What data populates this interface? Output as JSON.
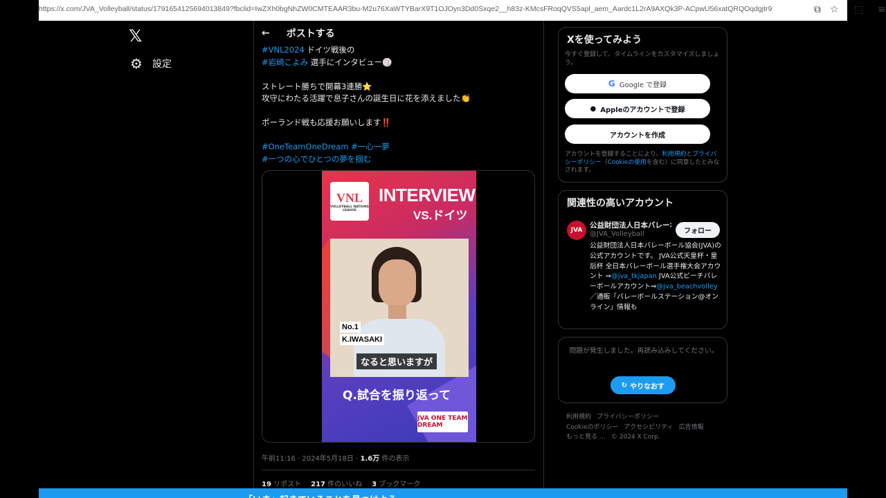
{
  "browser": {
    "url": "https://x.com/JVA_Volleyball/status/1791654125694013849?fbclid=IwZXh0bgNhZW0CMTEAAR3bu-M2u76XaWTYBarX9T1OJOyn3Dd0Sxqe2__h83z-KMcsFRoqQVS5apl_aem_Aardc1L2rA9AXQk3P-ACpwU56xatQRQOqdgjtr9T2..."
  },
  "nav": {
    "logo": "𝕏",
    "settings_label": "設定"
  },
  "post": {
    "header_title": "ポストする",
    "lines": [
      {
        "tag": "#VNL2024",
        "text": " ドイツ戦後の"
      },
      {
        "tag": "#岩崎こよみ",
        "text": " 選手にインタビュー🏐"
      },
      {
        "tag": "",
        "text": "ストレート勝ちで開幕3連勝⭐"
      },
      {
        "tag": "",
        "text": "攻守にわたる活躍で息子さんの誕生日に花を添えました👏"
      },
      {
        "tag": "",
        "text": "ポーランド戦も応援お願いします‼️"
      },
      {
        "tag": "#OneTeamOneDream #一心一夢",
        "text": ""
      },
      {
        "tag": "#一つの心でひとつの夢を掴む",
        "text": ""
      }
    ],
    "media": {
      "logo_text": "VNL",
      "logo_sub": "VOLLEYBALL NATIONS LEAGUE",
      "title": "INTERVIEW",
      "vs": "VS.ドイツ",
      "player_no": "No.1",
      "player_name": "K.IWASAKI",
      "subtitle": "なると思いますが",
      "question": "Q.試合を振り返って",
      "badge": "JVA ONE TEAM DREAM"
    },
    "time": "午前11:16 · 2024年5月18日 · ",
    "views": "1.6万",
    "views_label": " 件の表示",
    "retweets": "19",
    "retweets_label": " リポスト",
    "likes": "217",
    "likes_label": " 件のいいね",
    "bookmarks": "3",
    "bookmarks_label": " ブックマーク"
  },
  "signup": {
    "title": "Xを使ってみよう",
    "desc": "今すぐ登録して、タイムラインをカスタマイズしましょう。",
    "google_btn": "Google で登録",
    "apple_btn": "Appleのアカウントで登録",
    "create_btn": "アカウントを作成",
    "legal_prefix": "アカウントを登録することにより、",
    "legal_terms": "利用規約",
    "legal_and": "と",
    "legal_privacy": "プライバシーポリシー",
    "legal_cookie_open": "（",
    "legal_cookie": "Cookieの使用",
    "legal_suffix": "を含む）に同意したとみなされます。"
  },
  "related": {
    "title": "関連性の高いアカウント",
    "name": "公益財団法人日本バレーボール協会",
    "handle": "@JVA_Volleyball",
    "follow": "フォロー",
    "bio_1": "公益財団法人日本バレーボール協会(JVA)の公式アカウントです。 JVA公式天皇杯・皇后杯 全日本バレーボール選手権大会アカウント ⇒",
    "bio_link1": "@jva_tkjapan",
    "bio_2": " JVA公式ビーチバレーボールアカウント⇒",
    "bio_link2": "@jva_beachvolley",
    "bio_3": " ／通販「バレーボールステーション@オンライン」情報も"
  },
  "error_card": {
    "message": "問題が発生しました。再読み込みしてください。",
    "retry": "やりなおす"
  },
  "footer": {
    "items": [
      "利用規約",
      "プライバシーポリシー",
      "Cookieのポリシー",
      "アクセシビリティ",
      "広告情報",
      "もっと見る …",
      "© 2024 X Corp."
    ]
  },
  "bottom_banner": {
    "text": "「いま」起きていることを見つけよう"
  }
}
